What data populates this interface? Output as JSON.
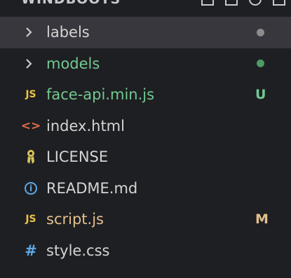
{
  "header": {
    "title": "WINDBOOTS"
  },
  "colors": {
    "background": "#1e1f22",
    "selected_row": "#37373d",
    "text_default": "#d4d4d4",
    "text_untracked": "#73c991",
    "text_modified": "#e2c08d",
    "dot_gray": "#8c8c8c",
    "dot_green": "#4e9a63",
    "js_yellow": "#e8c44a",
    "html_orange": "#e06c4b",
    "info_blue": "#5fa8e8",
    "license_yellow": "#d8c35a"
  },
  "tree": {
    "items": [
      {
        "label": "labels",
        "kind": "folder",
        "icon": "chevron-right-icon",
        "status": "",
        "status_dot": "gray"
      },
      {
        "label": "models",
        "kind": "folder",
        "icon": "chevron-right-icon",
        "status": "",
        "status_dot": "green"
      },
      {
        "label": "face-api.min.js",
        "kind": "file",
        "icon": "js-icon",
        "icon_text": "JS",
        "status": "U"
      },
      {
        "label": "index.html",
        "kind": "file",
        "icon": "html-icon",
        "icon_text": "<>",
        "status": ""
      },
      {
        "label": "LICENSE",
        "kind": "file",
        "icon": "license-icon",
        "status": ""
      },
      {
        "label": "README.md",
        "kind": "file",
        "icon": "info-icon",
        "icon_text": "i",
        "status": ""
      },
      {
        "label": "script.js",
        "kind": "file",
        "icon": "js-icon",
        "icon_text": "JS",
        "status": "M"
      },
      {
        "label": "style.css",
        "kind": "file",
        "icon": "hash-icon",
        "icon_text": "#",
        "status": ""
      }
    ]
  }
}
